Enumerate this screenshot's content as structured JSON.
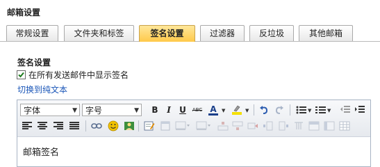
{
  "page_title": "邮箱设置",
  "tabs": [
    {
      "label": "常规设置"
    },
    {
      "label": "文件夹和标签"
    },
    {
      "label": "签名设置",
      "active": true
    },
    {
      "label": "过滤器"
    },
    {
      "label": "反垃圾"
    },
    {
      "label": "其他邮箱"
    }
  ],
  "signature": {
    "section_title": "签名设置",
    "show_signature_label": "在所有发送邮件中显示签名",
    "show_signature_checked": true,
    "switch_plain_text_link": "切换到纯文本",
    "editor_content": "邮箱签名"
  },
  "toolbar": {
    "font_select": "字体",
    "size_select": "字号",
    "bold": "B",
    "italic": "I",
    "underline": "U",
    "strike": "ABC",
    "font_color": "A"
  },
  "colors": {
    "active_tab": "#ffc94a",
    "link": "#1a56b8",
    "checkbox_check": "#1e7a1e",
    "smiley": "#f2c200"
  }
}
